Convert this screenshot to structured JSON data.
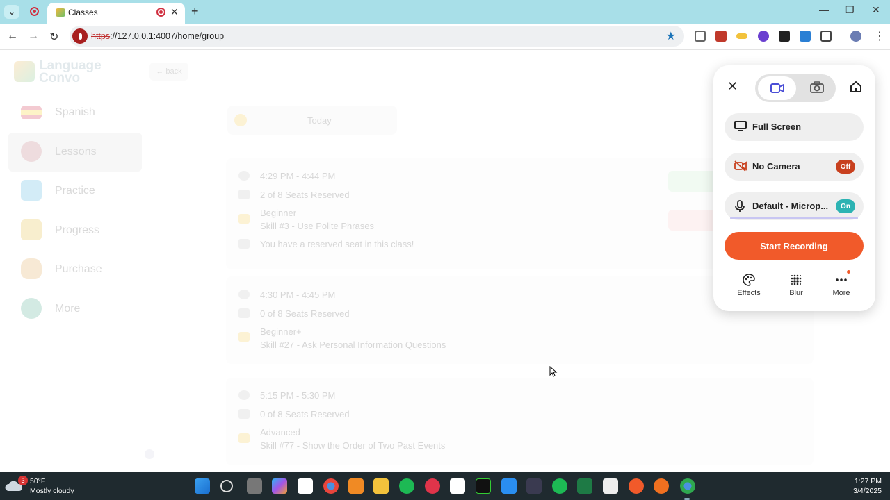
{
  "browser": {
    "tab_title": "Classes",
    "url_scheme": "https",
    "url_rest": "://127.0.0.1:4007/home/group"
  },
  "app": {
    "logo_line1": "Language",
    "logo_line2": "Convo",
    "back_label": "← back",
    "nav": [
      {
        "label": "Spanish"
      },
      {
        "label": "Lessons"
      },
      {
        "label": "Practice"
      },
      {
        "label": "Progress"
      },
      {
        "label": "Purchase"
      },
      {
        "label": "More"
      }
    ],
    "today_label": "Today",
    "classes": [
      {
        "time": "4:29 PM - 4:44 PM",
        "seats": "2 of 8 Seats Reserved",
        "level": "Beginner",
        "skill": "Skill #3 - Use Polite Phrases",
        "note": "You have a reserved seat in this class!"
      },
      {
        "time": "4:30 PM - 4:45 PM",
        "seats": "0 of 8 Seats Reserved",
        "level": "Beginner+",
        "skill": "Skill #27 - Ask Personal Information Questions"
      },
      {
        "time": "5:15 PM - 5:30 PM",
        "seats": "0 of 8 Seats Reserved",
        "level": "Advanced",
        "skill": "Skill #77 - Show the Order of Two Past Events"
      }
    ]
  },
  "recorder": {
    "full_screen": "Full Screen",
    "camera": "No Camera",
    "camera_state": "Off",
    "mic": "Default - Microp...",
    "mic_state": "On",
    "start": "Start Recording",
    "tools": [
      "Effects",
      "Blur",
      "More"
    ]
  },
  "taskbar": {
    "weather_temp": "50°F",
    "weather_desc": "Mostly cloudy",
    "weather_badge": "3",
    "time": "1:27 PM",
    "date": "3/4/2025"
  },
  "colors": {
    "accent": "#f15a2a",
    "off_pill": "#c8401e",
    "on_pill": "#2cb3b3",
    "video_icon": "#4b4fd6"
  }
}
